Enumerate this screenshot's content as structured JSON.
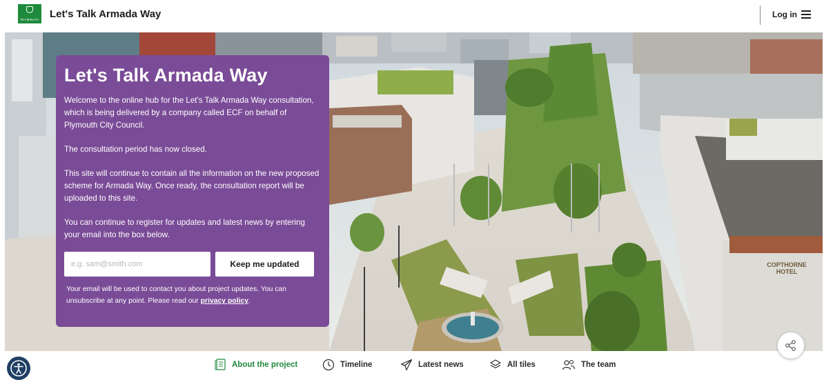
{
  "header": {
    "logo_text": "PLYMOUTH",
    "title": "Let's Talk Armada Way",
    "login_label": "Log in"
  },
  "panel": {
    "title": "Let's Talk Armada Way",
    "para1": "Welcome to the online hub for the Let's Talk Armada Way consultation, which is being delivered by a company called ECF on behalf of Plymouth City Council.",
    "para2": "The consultation period has now closed.",
    "para3": "This site will continue to contain all the information on the new proposed scheme for Armada Way. Once ready, the consultation report will be uploaded to this site.",
    "para4": "You can continue to register for updates and latest news by entering your email into the box below.",
    "email_placeholder": "e.g. sam@smith.com",
    "email_value": "",
    "submit_label": "Keep me updated",
    "note_text": "Your email will be used to contact you about project updates. You can unsubscribe at any point. Please read our ",
    "note_link": "privacy policy",
    "note_end": "."
  },
  "hero_sign": {
    "line1": "COPTHORNE",
    "line2": "HOTEL"
  },
  "nav": {
    "items": [
      {
        "label": "About the project",
        "icon": "document-icon",
        "active": true
      },
      {
        "label": "Timeline",
        "icon": "clock-icon",
        "active": false
      },
      {
        "label": "Latest news",
        "icon": "paper-plane-icon",
        "active": false
      },
      {
        "label": "All tiles",
        "icon": "layers-icon",
        "active": false
      },
      {
        "label": "The team",
        "icon": "people-icon",
        "active": false
      }
    ]
  },
  "colors": {
    "panel": "#7a4b97",
    "active_nav": "#1e8a3c",
    "logo_green": "#1e8a3c",
    "accessibility": "#1f3f63"
  }
}
